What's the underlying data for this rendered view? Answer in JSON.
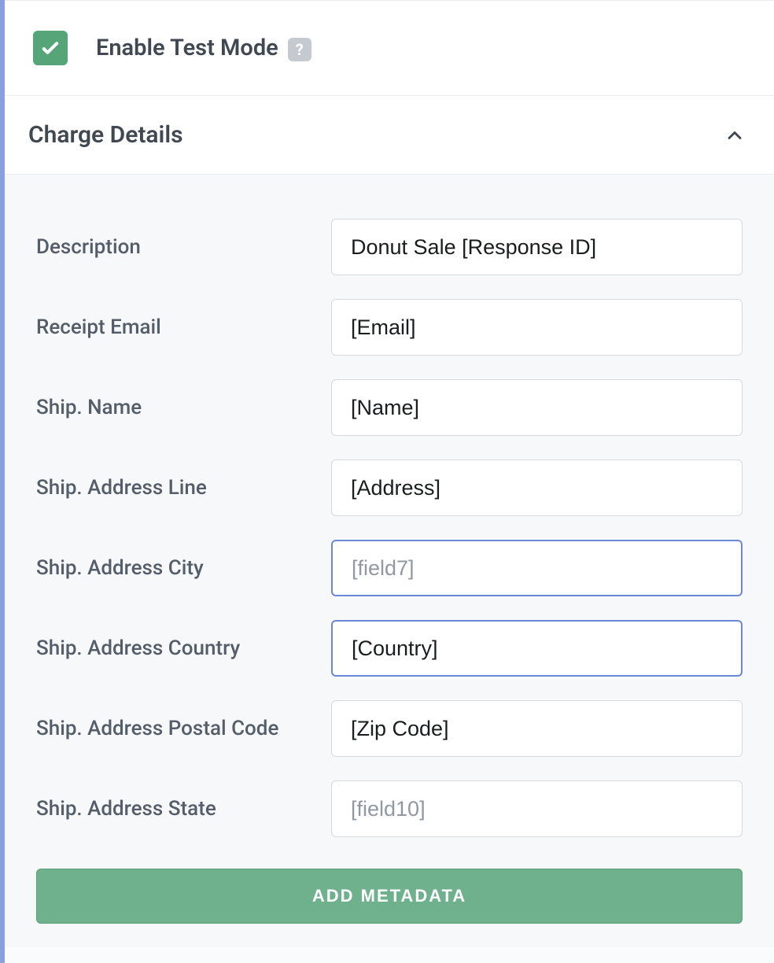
{
  "testMode": {
    "label": "Enable Test Mode",
    "checked": true,
    "helpIcon": "?"
  },
  "section": {
    "title": "Charge Details",
    "expanded": true
  },
  "fields": {
    "description": {
      "label": "Description",
      "value": "Donut Sale [Response ID]"
    },
    "receiptEmail": {
      "label": "Receipt Email",
      "value": "[Email]"
    },
    "shipName": {
      "label": "Ship. Name",
      "value": "[Name]"
    },
    "shipAddressLine": {
      "label": "Ship. Address Line",
      "value": "[Address]"
    },
    "shipAddressCity": {
      "label": "Ship. Address City",
      "value": "",
      "placeholder": "[field7]",
      "selected": true
    },
    "shipAddressCountry": {
      "label": "Ship. Address Country",
      "value": "[Country]",
      "selected": true
    },
    "shipAddressPostalCode": {
      "label": "Ship. Address Postal Code",
      "value": "[Zip Code]"
    },
    "shipAddressState": {
      "label": "Ship. Address State",
      "value": "",
      "placeholder": "[field10]"
    }
  },
  "buttons": {
    "addMetadata": "ADD METADATA"
  }
}
